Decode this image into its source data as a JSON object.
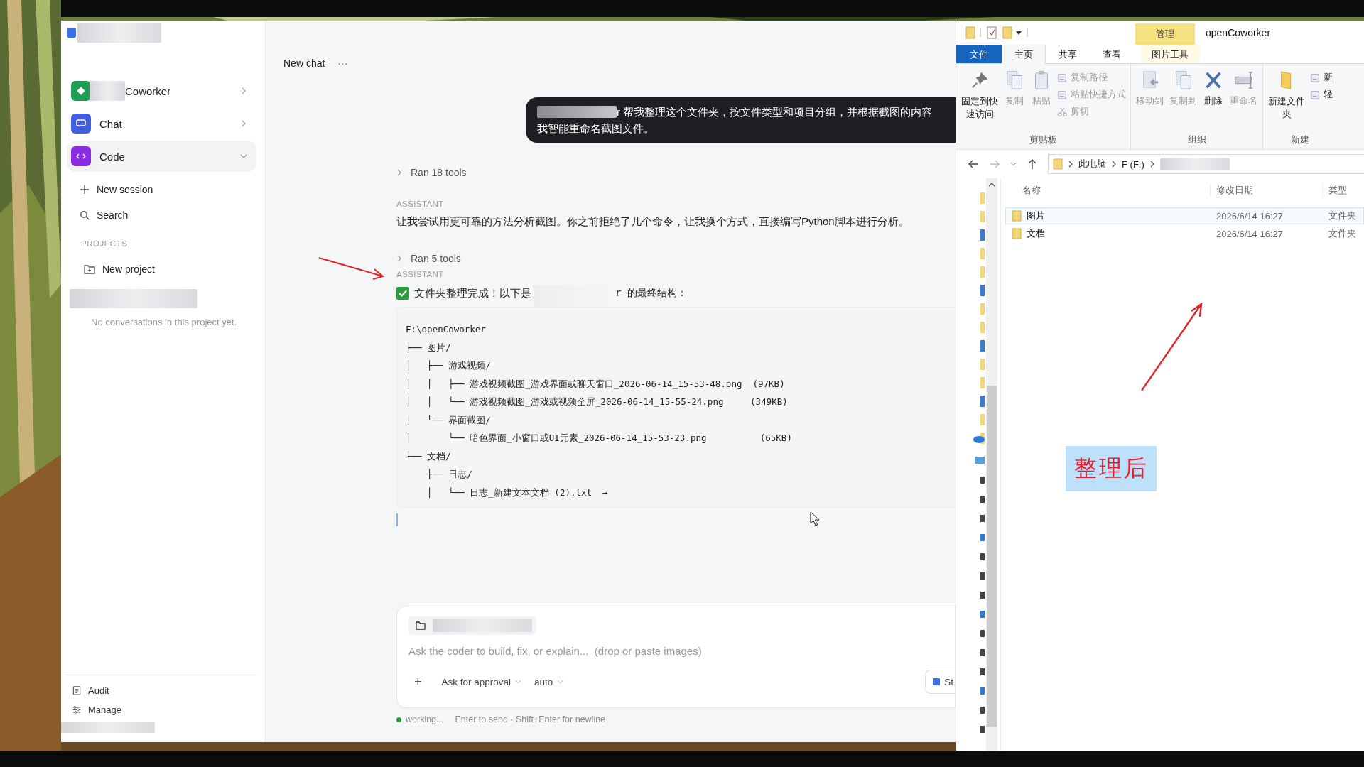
{
  "app": {
    "sidebar": {
      "items": [
        {
          "label": "Coworker",
          "kind": "coworker",
          "color": "#1f9d55",
          "selected": false,
          "expanded": false
        },
        {
          "label": "Chat",
          "kind": "chat",
          "color": "#3f5fe0",
          "selected": false,
          "expanded": false
        },
        {
          "label": "Code",
          "kind": "code",
          "color": "#8b2be2",
          "selected": true,
          "expanded": true
        }
      ],
      "actions": [
        {
          "label": "New session",
          "kind": "plus"
        },
        {
          "label": "Search",
          "kind": "search"
        }
      ],
      "projects_heading": "PROJECTS",
      "new_project": "New project",
      "empty_note": "No conversations in this project yet.",
      "footer": [
        {
          "label": "Audit",
          "kind": "audit"
        },
        {
          "label": "Manage",
          "kind": "manage"
        }
      ]
    },
    "chat": {
      "title": "New chat",
      "menu": "···",
      "messages": [
        {
          "kind": "user",
          "text": "r 帮我整理这个文件夹，按文件类型和项目分组，并根据截图的内容",
          "text_2": "我智能重命名截图文件。"
        },
        {
          "kind": "tools",
          "text": "Ran 18 tools"
        },
        {
          "kind": "assistant",
          "role": "ASSISTANT",
          "text": "让我尝试用更可靠的方法分析截图。你之前拒绝了几个命令，让我换个方式，直接编写Python脚本进行分析。"
        },
        {
          "kind": "tools",
          "text": "Ran 5 tools"
        },
        {
          "kind": "result",
          "role": "ASSISTANT",
          "text": "文件夹整理完成！以下是",
          "text_2": "r 的最终结构：",
          "code_lines": [
            "F:\\openCoworker",
            "├── 图片/",
            "│   ├── 游戏视频/",
            "│   │   ├── 游戏视频截图_游戏界面或聊天窗口_2026-06-14_15-53-48.png  (97KB)",
            "│   │   └── 游戏视频截图_游戏或视频全屏_2026-06-14_15-55-24.png     (349KB)",
            "│   └── 界面截图/",
            "│       └── 暗色界面_小窗口或UI元素_2026-06-14_15-53-23.png          (65KB)",
            "└── 文档/",
            "    ├── 日志/",
            "    │   └── 日志_新建文本文档 (2).txt  →"
          ]
        }
      ],
      "composer": {
        "placeholder": "Ask the coder to build, fix, or explain...  (drop or paste images)",
        "add": "+",
        "approval": "Ask for approval",
        "mode": "auto",
        "stop": "St"
      },
      "status": {
        "state": "working...",
        "hint": "Enter to send · Shift+Enter for newline"
      }
    }
  },
  "explorer": {
    "context_tab": "管理",
    "title": "openCoworker",
    "tabs": [
      {
        "label": "文件",
        "kind": "file",
        "selected": false
      },
      {
        "label": "主页",
        "kind": "plain",
        "selected": true
      },
      {
        "label": "共享",
        "kind": "plain",
        "selected": false
      },
      {
        "label": "查看",
        "kind": "plain",
        "selected": false
      },
      {
        "label": "图片工具",
        "kind": "context",
        "selected": false
      }
    ],
    "groups": [
      {
        "label": "剪贴板",
        "large": [
          {
            "label": "固定到快速访问",
            "kind": "pin",
            "disabled": false
          },
          {
            "label": "复制",
            "kind": "copy",
            "disabled": true
          },
          {
            "label": "粘贴",
            "kind": "paste",
            "disabled": true
          }
        ],
        "small": [
          {
            "label": "复制路径",
            "kind": "path",
            "disabled": true
          },
          {
            "label": "粘贴快捷方式",
            "kind": "shortcut",
            "disabled": true
          },
          {
            "label": "剪切",
            "kind": "cut",
            "disabled": true
          }
        ]
      },
      {
        "label": "组织",
        "large": [
          {
            "label": "移动到",
            "kind": "move",
            "disabled": true
          },
          {
            "label": "复制到",
            "kind": "copyto",
            "disabled": true
          },
          {
            "label": "删除",
            "kind": "delete",
            "disabled": false
          },
          {
            "label": "重命名",
            "kind": "rename",
            "disabled": true
          }
        ]
      },
      {
        "label": "新建",
        "large": [
          {
            "label": "新建文件夹",
            "kind": "folder",
            "disabled": false
          }
        ],
        "small": [
          {
            "label": "新",
            "kind": "newitem",
            "disabled": false
          },
          {
            "label": "轻",
            "kind": "easy",
            "disabled": false
          }
        ]
      }
    ],
    "path": [
      "此电脑",
      "F (F:)"
    ],
    "columns": [
      "名称",
      "修改日期",
      "类型"
    ],
    "rows": [
      {
        "name": "图片",
        "date": "2026/6/14 16:27",
        "type": "文件夹",
        "selected": true
      },
      {
        "name": "文档",
        "date": "2026/6/14 16:27",
        "type": "文件夹",
        "selected": false
      }
    ]
  },
  "annotation": {
    "label": "整理后"
  }
}
